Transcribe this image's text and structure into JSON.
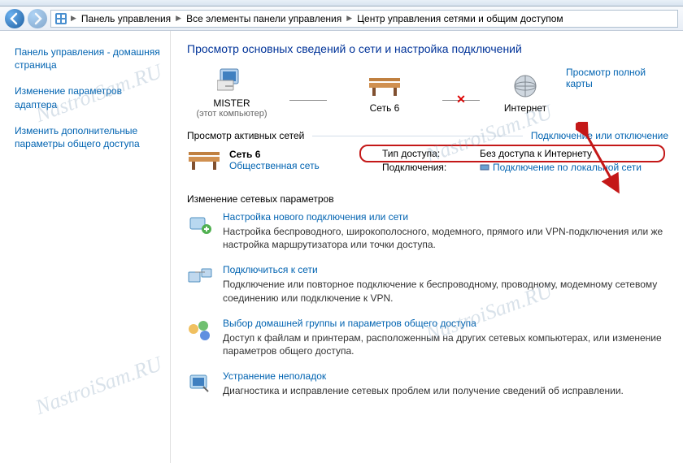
{
  "breadcrumb": {
    "items": [
      "Панель управления",
      "Все элементы панели управления",
      "Центр управления сетями и общим доступом"
    ]
  },
  "sidebar": {
    "links": [
      "Панель управления - домашняя страница",
      "Изменение параметров адаптера",
      "Изменить дополнительные параметры общего доступа"
    ]
  },
  "heading": "Просмотр основных сведений о сети и настройка подключений",
  "map": {
    "node1": {
      "name": "MISTER",
      "sub": "(этот компьютер)"
    },
    "node2": {
      "name": "Сеть 6"
    },
    "node3": {
      "name": "Интернет"
    },
    "full_map_link": "Просмотр полной карты"
  },
  "active_networks": {
    "label": "Просмотр активных сетей",
    "toggle_link": "Подключение или отключение",
    "network": {
      "name": "Сеть 6",
      "type": "Общественная сеть",
      "access_label": "Тип доступа:",
      "access_value": "Без доступа к Интернету",
      "connections_label": "Подключения:",
      "connection_link": "Подключение по локальной сети"
    }
  },
  "settings": {
    "label": "Изменение сетевых параметров",
    "tasks": [
      {
        "title": "Настройка нового подключения или сети",
        "desc": "Настройка беспроводного, широкополосного, модемного, прямого или VPN-подключения или же настройка маршрутизатора или точки доступа."
      },
      {
        "title": "Подключиться к сети",
        "desc": "Подключение или повторное подключение к беспроводному, проводному, модемному сетевому соединению или подключение к VPN."
      },
      {
        "title": "Выбор домашней группы и параметров общего доступа",
        "desc": "Доступ к файлам и принтерам, расположенным на других сетевых компьютерах, или изменение параметров общего доступа."
      },
      {
        "title": "Устранение неполадок",
        "desc": "Диагностика и исправление сетевых проблем или получение сведений об исправлении."
      }
    ]
  },
  "watermark_text": "NastroiSam.RU"
}
